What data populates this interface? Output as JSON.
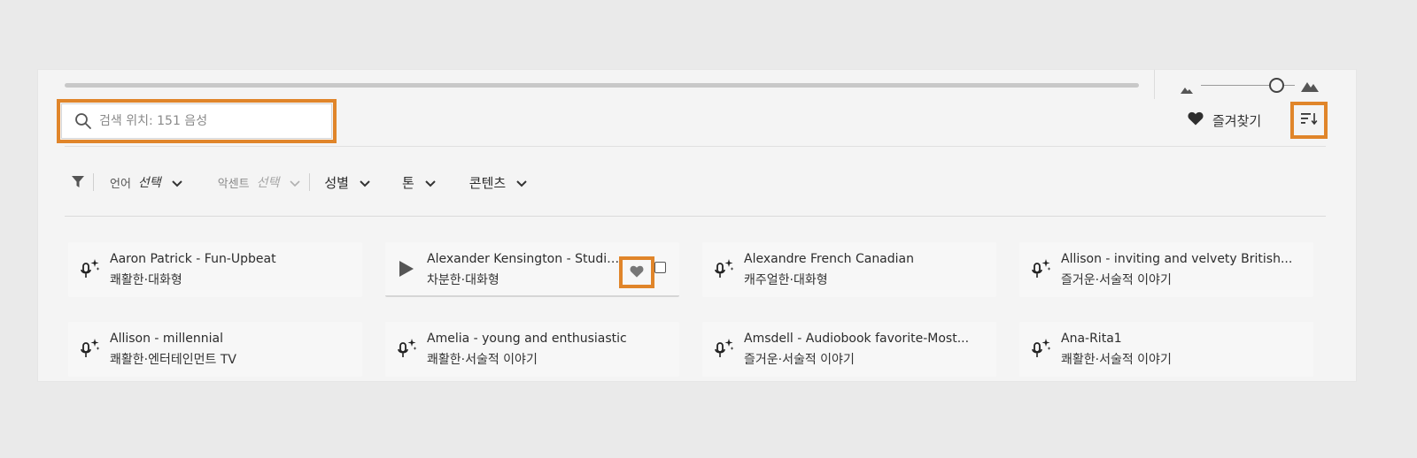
{
  "search": {
    "placeholder": "검색 위치: 151 음성",
    "icon": "search-icon"
  },
  "preview": {
    "progress_percent": 0
  },
  "zoom": {
    "level_fraction": 0.81,
    "small_icon": "mountain-small-icon",
    "large_icon": "mountain-large-icon"
  },
  "favorites": {
    "label": "즐겨찾기",
    "icon": "heart-icon"
  },
  "sort": {
    "icon": "sort-icon"
  },
  "filters": {
    "language": {
      "label": "언어",
      "value": "선택"
    },
    "accent": {
      "label": "악센트",
      "value": "선택"
    },
    "gender": {
      "label": "성별"
    },
    "tone": {
      "label": "톤"
    },
    "content": {
      "label": "콘텐츠"
    }
  },
  "voices": [
    {
      "name": "Aaron Patrick - Fun-Upbeat",
      "tags": "쾌활한·대화형"
    },
    {
      "name": "Alexander Kensington - Studio...",
      "tags": "차분한·대화형"
    },
    {
      "name": "Alexandre French Canadian",
      "tags": "캐주얼한·대화형"
    },
    {
      "name": "Allison - inviting and velvety British...",
      "tags": "즐거운·서술적 이야기"
    },
    {
      "name": "Allison - millennial",
      "tags": "쾌활한·엔터테인먼트 TV"
    },
    {
      "name": "Amelia - young and enthusiastic",
      "tags": "쾌활한·서술적 이야기"
    },
    {
      "name": "Amsdell - Audiobook favorite-Most...",
      "tags": "즐거운·서술적 이야기"
    },
    {
      "name": "Ana-Rita1",
      "tags": "쾌활한·서술적 이야기"
    }
  ],
  "colors": {
    "highlight": "#e0852a",
    "panel_bg": "#f4f4f4",
    "page_bg": "#eaeaea"
  }
}
